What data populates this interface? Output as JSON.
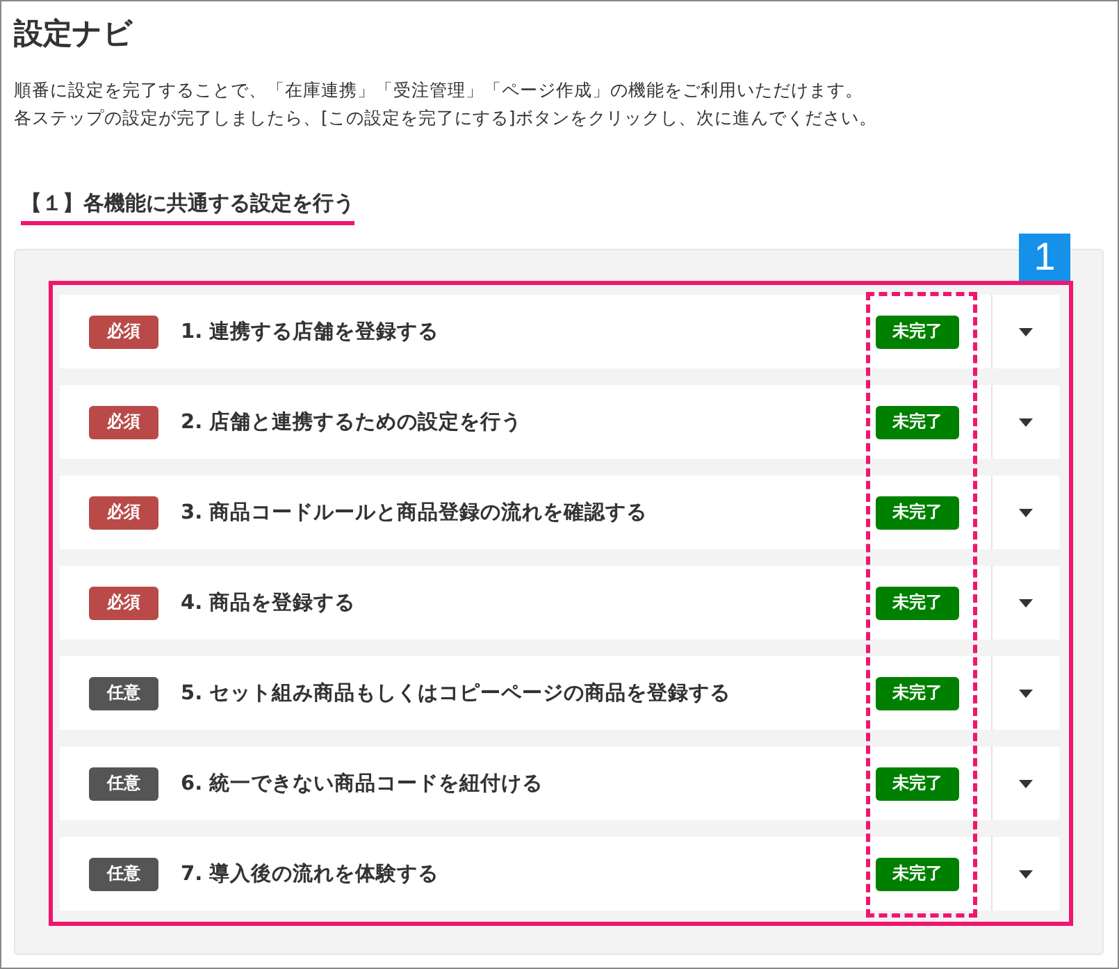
{
  "title": "設定ナビ",
  "description": [
    "順番に設定を完了することで、「在庫連携」「受注管理」「ページ作成」の機能をご利用いただけます。",
    "各ステップの設定が完了しましたら、[この設定を完了にする]ボタンをクリックし、次に進んでください。"
  ],
  "section_heading": "【１】各機能に共通する設定を行う",
  "annotation_label": "1",
  "steps": [
    {
      "tag": "必須",
      "kind": "required",
      "title": "1. 連携する店舗を登録する",
      "status": "未完了"
    },
    {
      "tag": "必須",
      "kind": "required",
      "title": "2. 店舗と連携するための設定を行う",
      "status": "未完了"
    },
    {
      "tag": "必須",
      "kind": "required",
      "title": "3. 商品コードルールと商品登録の流れを確認する",
      "status": "未完了"
    },
    {
      "tag": "必須",
      "kind": "required",
      "title": "4. 商品を登録する",
      "status": "未完了"
    },
    {
      "tag": "任意",
      "kind": "optional",
      "title": "5. セット組み商品もしくはコピーページの商品を登録する",
      "status": "未完了"
    },
    {
      "tag": "任意",
      "kind": "optional",
      "title": "6. 統一できない商品コードを紐付ける",
      "status": "未完了"
    },
    {
      "tag": "任意",
      "kind": "optional",
      "title": "7. 導入後の流れを体験する",
      "status": "未完了"
    }
  ]
}
